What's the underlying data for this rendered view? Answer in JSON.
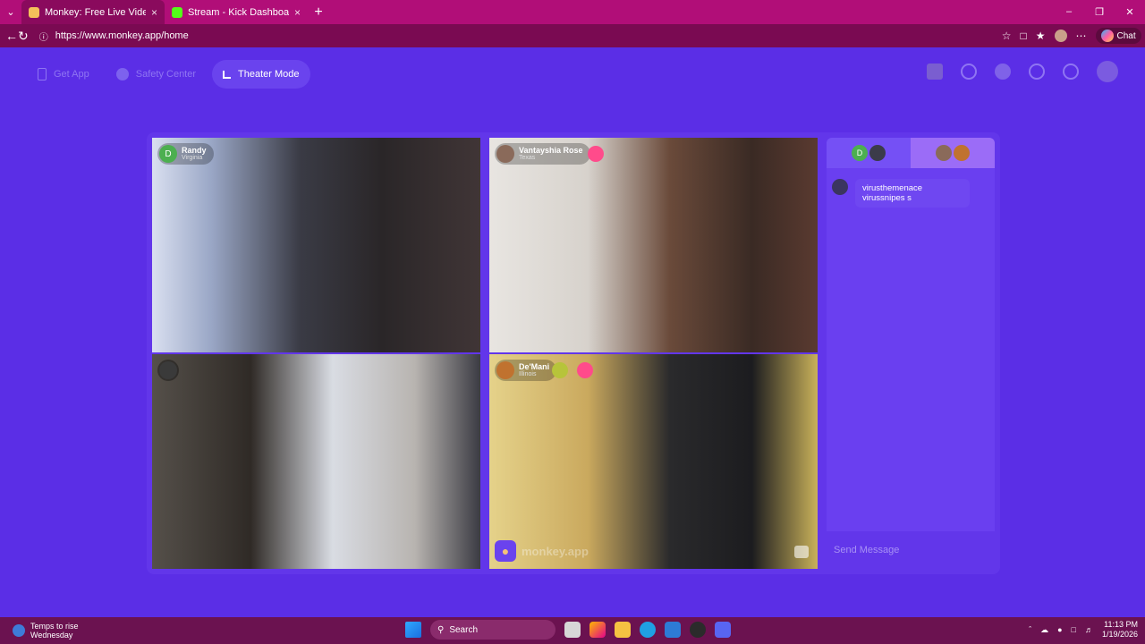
{
  "browser": {
    "tabs": [
      {
        "title": "Monkey: Free Live Video Chat",
        "active": true
      },
      {
        "title": "Stream - Kick Dashboard",
        "active": false
      }
    ],
    "url": "https://www.monkey.app/home",
    "copilot_label": "Chat"
  },
  "app": {
    "nav": {
      "get_app": "Get App",
      "safety_center": "Safety Center",
      "theater_mode": "Theater Mode"
    },
    "participants": [
      {
        "name": "Randy",
        "state": "Virginia",
        "avatar_letter": "D"
      },
      {
        "name": "Vantayshia Rose",
        "state": "Texas"
      },
      {
        "name": "",
        "state": ""
      },
      {
        "name": "De'Mani",
        "state": "Illinois"
      }
    ],
    "watermark": "monkey.app",
    "chat": {
      "tab1_letter": "D",
      "messages": [
        {
          "text": "virusthemenace virussnipes s"
        }
      ],
      "send_placeholder": "Send Message"
    }
  },
  "taskbar": {
    "weather_title": "Temps to rise",
    "weather_sub": "Wednesday",
    "search_label": "Search",
    "time": "11:13 PM",
    "date": "1/19/2026"
  }
}
